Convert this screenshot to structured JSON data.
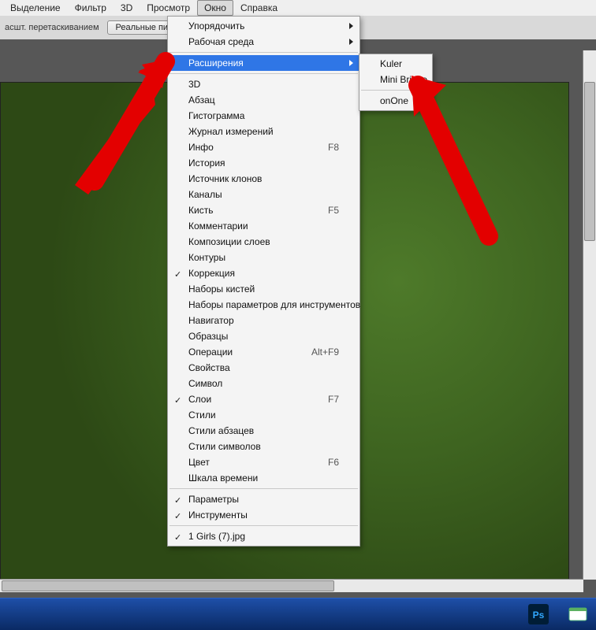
{
  "menubar": {
    "items": [
      {
        "label": "Выделение"
      },
      {
        "label": "Фильтр"
      },
      {
        "label": "3D"
      },
      {
        "label": "Просмотр"
      },
      {
        "label": "Окно",
        "open": true
      },
      {
        "label": "Справка"
      }
    ]
  },
  "toolbar": {
    "drag_label": "асшт. перетаскиванием",
    "real_pixels": "Реальные пикселы"
  },
  "window_menu": {
    "items": [
      {
        "label": "Упорядочить",
        "arrow": true
      },
      {
        "label": "Рабочая среда",
        "arrow": true
      },
      {
        "sep": true
      },
      {
        "label": "Расширения",
        "arrow": true,
        "hl": true
      },
      {
        "sep": true
      },
      {
        "label": "3D"
      },
      {
        "label": "Абзац"
      },
      {
        "label": "Гистограмма"
      },
      {
        "label": "Журнал измерений"
      },
      {
        "label": "Инфо",
        "shortcut": "F8"
      },
      {
        "label": "История"
      },
      {
        "label": "Источник клонов"
      },
      {
        "label": "Каналы"
      },
      {
        "label": "Кисть",
        "shortcut": "F5"
      },
      {
        "label": "Комментарии"
      },
      {
        "label": "Композиции слоев"
      },
      {
        "label": "Контуры"
      },
      {
        "label": "Коррекция",
        "check": true
      },
      {
        "label": "Наборы кистей"
      },
      {
        "label": "Наборы параметров для инструментов"
      },
      {
        "label": "Навигатор"
      },
      {
        "label": "Образцы"
      },
      {
        "label": "Операции",
        "shortcut": "Alt+F9"
      },
      {
        "label": "Свойства"
      },
      {
        "label": "Символ"
      },
      {
        "label": "Слои",
        "check": true,
        "shortcut": "F7"
      },
      {
        "label": "Стили"
      },
      {
        "label": "Стили абзацев"
      },
      {
        "label": "Стили символов"
      },
      {
        "label": "Цвет",
        "shortcut": "F6"
      },
      {
        "label": "Шкала времени"
      },
      {
        "sep": true
      },
      {
        "label": "Параметры",
        "check": true
      },
      {
        "label": "Инструменты",
        "check": true
      },
      {
        "sep": true
      },
      {
        "label": "1 Girls (7).jpg",
        "check": true
      }
    ]
  },
  "ext_submenu": {
    "items": [
      {
        "label": "Kuler"
      },
      {
        "label": "Mini Bridge"
      },
      {
        "sep": true
      },
      {
        "label": "onOne"
      }
    ]
  }
}
